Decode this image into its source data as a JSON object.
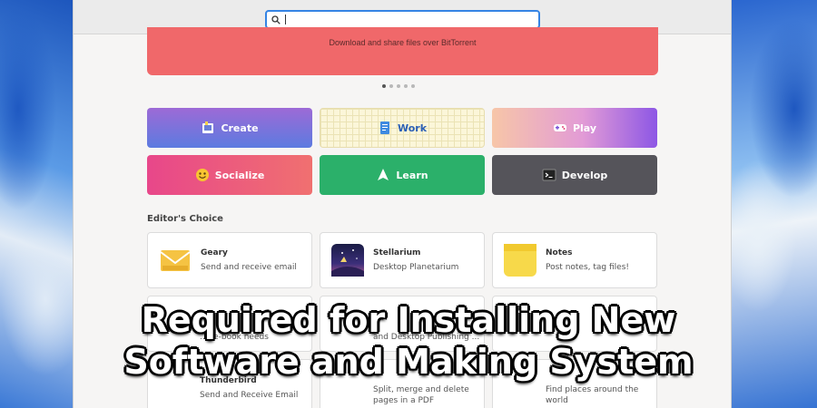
{
  "search": {
    "value": ""
  },
  "banner": {
    "text": "Download and share files over BitTorrent",
    "color": "#f0686a"
  },
  "carousel": {
    "count": 5,
    "active": 1
  },
  "categories": [
    {
      "label": "Create",
      "icon": "palette-icon"
    },
    {
      "label": "Work",
      "icon": "document-icon"
    },
    {
      "label": "Play",
      "icon": "gamepad-icon"
    },
    {
      "label": "Socialize",
      "icon": "smiley-icon"
    },
    {
      "label": "Learn",
      "icon": "compass-icon"
    },
    {
      "label": "Develop",
      "icon": "terminal-icon"
    }
  ],
  "editors_choice": {
    "title": "Editor's Choice",
    "apps": [
      {
        "name": "Geary",
        "desc": "Send and receive email",
        "icon": "envelope-icon"
      },
      {
        "name": "Stellarium",
        "desc": "Desktop Planetarium",
        "icon": "planetarium-icon"
      },
      {
        "name": "Notes",
        "desc": "Post notes, tag files!",
        "icon": "sticky-note-icon"
      }
    ],
    "partial": {
      "row2_col1": "...r e-book needs",
      "row2_col2": "and Desktop Publishing ...",
      "row3_col1_name": "Thunderbird",
      "row3_col1_desc": "Send and Receive Email",
      "row3_col2_desc": "Split, merge and delete pages in a PDF",
      "row3_col3_desc": "Find places around the world"
    }
  },
  "overlay": {
    "line1": "Required for Installing New",
    "line2": "Software and Making System"
  }
}
